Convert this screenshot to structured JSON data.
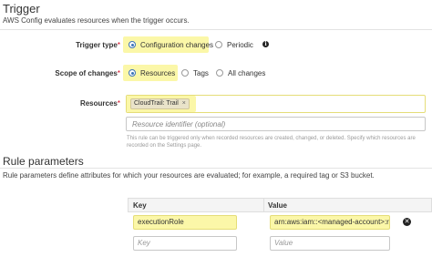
{
  "trigger": {
    "heading": "Trigger",
    "description": "AWS Config evaluates resources when the trigger occurs.",
    "trigger_type": {
      "label": "Trigger type",
      "required_mark": "*",
      "options": [
        "Configuration changes",
        "Periodic"
      ],
      "selected": "Configuration changes",
      "info_icon": "info-icon"
    },
    "scope": {
      "label": "Scope of changes",
      "required_mark": "*",
      "options": [
        "Resources",
        "Tags",
        "All changes"
      ],
      "selected": "Resources"
    },
    "resources": {
      "label": "Resources",
      "required_mark": "*",
      "tag": "CloudTrail: Trail",
      "tag_remove": "×",
      "identifier_placeholder": "Resource identifier (optional)",
      "help_line1": "This rule can be triggered only when recorded resources are created, changed, or deleted. Specify which resources are",
      "help_line2": "recorded on the Settings page."
    }
  },
  "rule_parameters": {
    "heading": "Rule parameters",
    "description": "Rule parameters define attributes for which your resources are evaluated; for example, a required tag or S3 bucket.",
    "columns": [
      "Key",
      "Value"
    ],
    "rows": [
      {
        "key": "executionRole",
        "value": "arn:aws:iam::<managed-account>:role"
      }
    ],
    "new_row": {
      "key_placeholder": "Key",
      "value_placeholder": "Value"
    },
    "remove_icon": "remove-icon"
  },
  "colors": {
    "highlight": "#fbf7a8",
    "accent": "#3b73b9"
  }
}
